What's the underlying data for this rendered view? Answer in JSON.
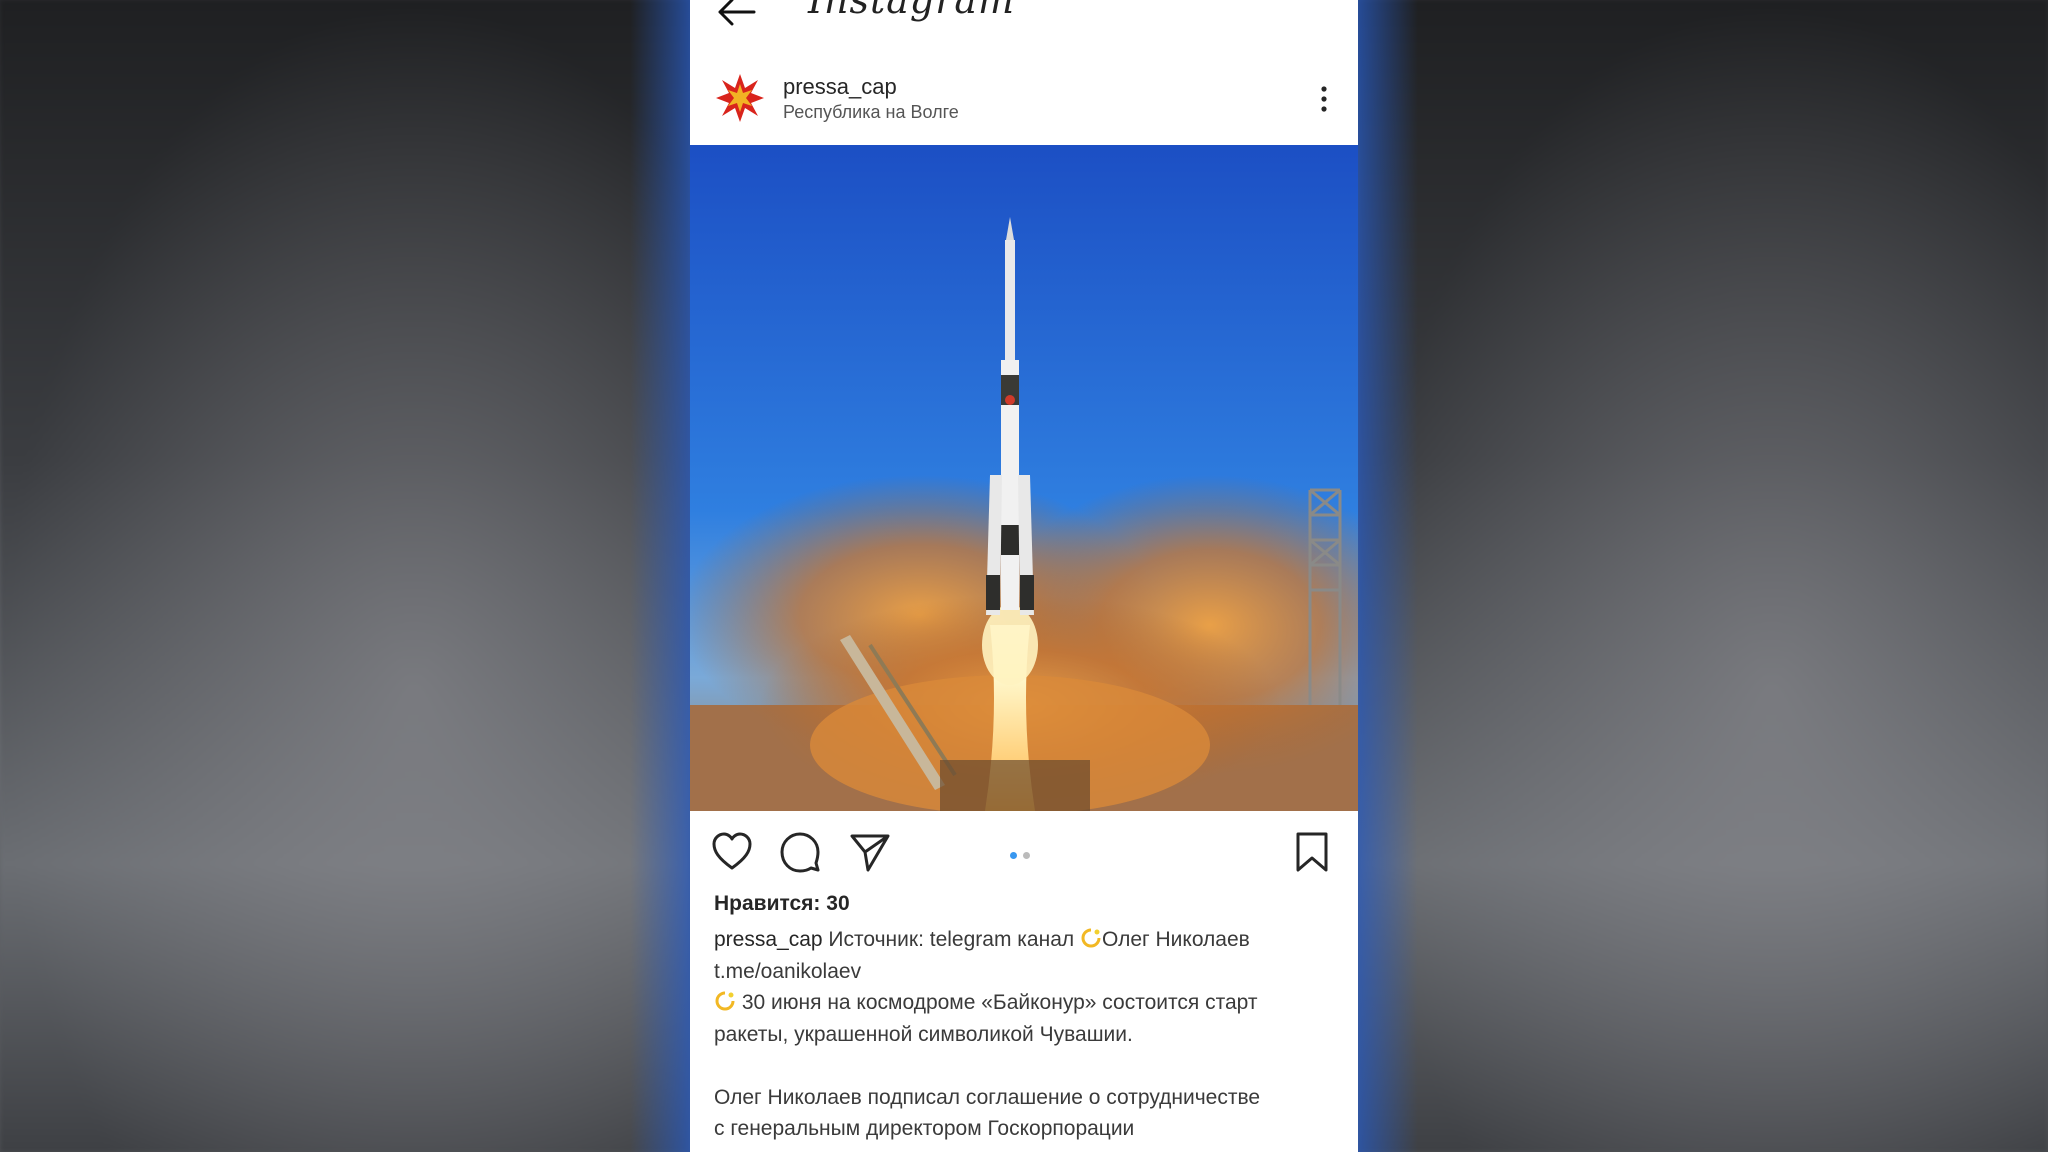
{
  "app": {
    "brand": "Instagram"
  },
  "post": {
    "username": "pressa_cap",
    "location": "Республика на Волге",
    "likes": "Нравится: 30",
    "caption": {
      "username": "pressa_cap",
      "line1": "Источник: telegram канал",
      "line1_tail": "Олег Николаев",
      "line2": "t.me/oanikolaev",
      "line3": "30 июня на космодроме «Байконур» состоится старт",
      "line4": "ракеты, украшенной символикой Чувашии.",
      "line5": "Олег Николаев подписал соглашение о сотрудничестве",
      "line6": "с генеральным директором Госкорпорации"
    },
    "carousel": {
      "count": 2,
      "active_index": 0
    }
  },
  "icons": {
    "back": "arrow-left-icon",
    "more": "more-vertical-icon",
    "like": "heart-icon",
    "comment": "comment-icon",
    "share": "send-icon",
    "save": "bookmark-icon",
    "avatar": "chuvash-emblem-icon",
    "emoji": "dizzy-emoji-icon"
  },
  "colors": {
    "accent": "#3897f0",
    "text": "#262626",
    "sky": "#1f56c9"
  }
}
